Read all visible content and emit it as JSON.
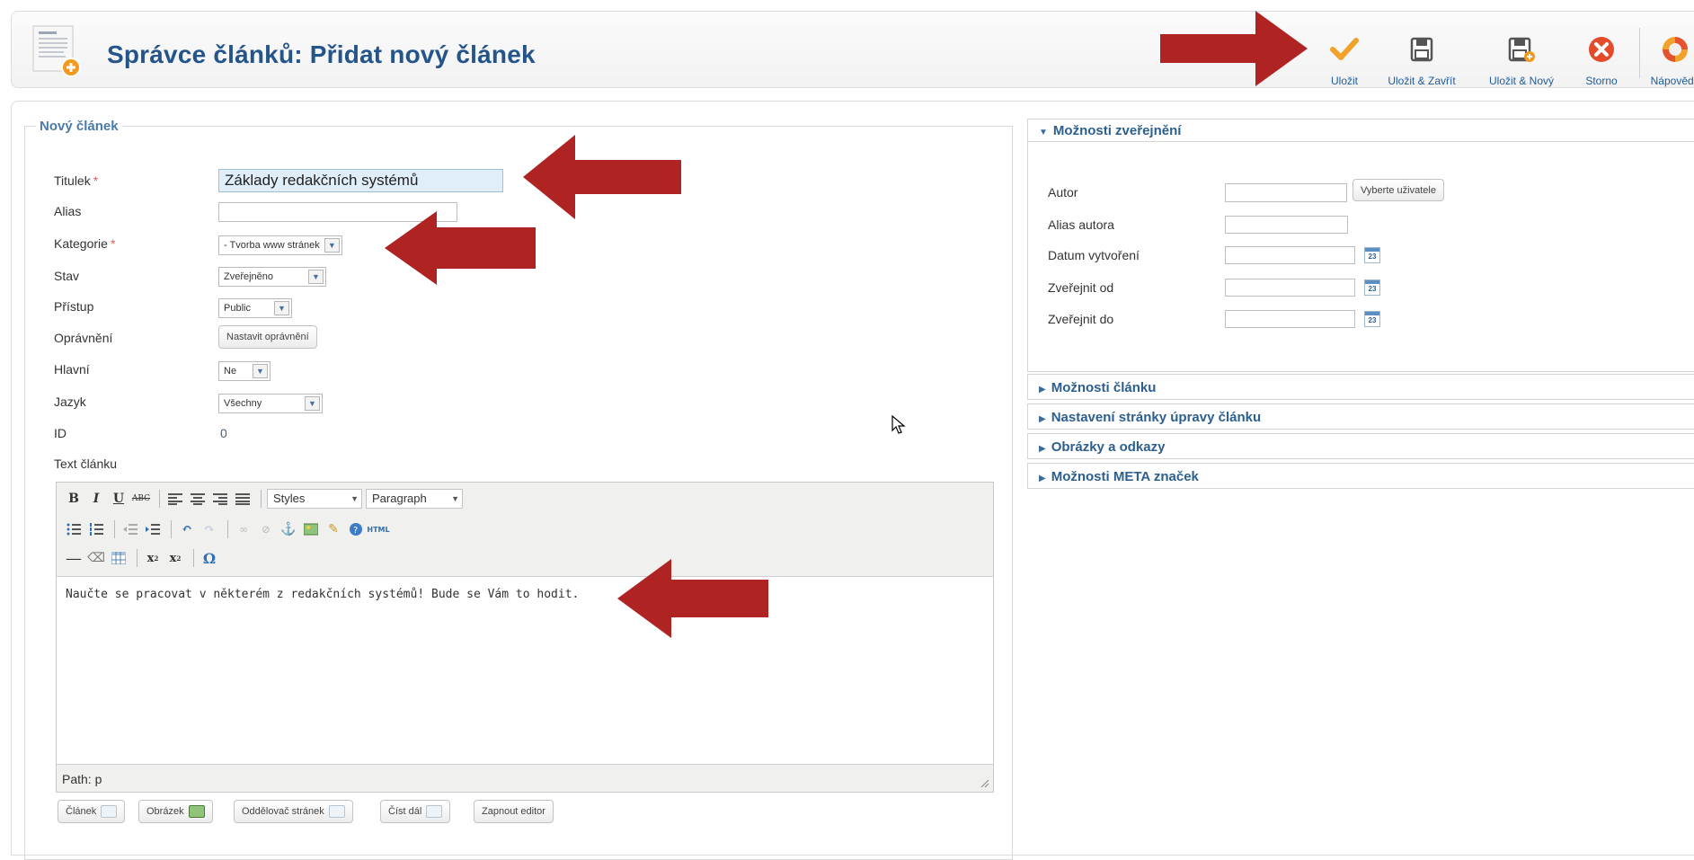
{
  "header": {
    "title": "Správce článků: Přidat nový článek",
    "toolbar": [
      {
        "label": "Uložit",
        "icon": "checkmark-icon"
      },
      {
        "label": "Uložit & Zavřít",
        "icon": "save-icon"
      },
      {
        "label": "Uložit & Nový",
        "icon": "save-new-icon"
      },
      {
        "label": "Storno",
        "icon": "cancel-icon"
      },
      {
        "label": "Nápověda",
        "icon": "help-icon"
      }
    ]
  },
  "form": {
    "legend": "Nový článek",
    "fields": {
      "title": {
        "label": "Titulek",
        "value": "Základy redakčních systémů"
      },
      "alias": {
        "label": "Alias",
        "value": ""
      },
      "category": {
        "label": "Kategorie",
        "value": "- Tvorba www stránek"
      },
      "state": {
        "label": "Stav",
        "value": "Zveřejněno"
      },
      "access": {
        "label": "Přístup",
        "value": "Public"
      },
      "permissions": {
        "label": "Oprávnění",
        "button": "Nastavit oprávnění"
      },
      "featured": {
        "label": "Hlavní",
        "value": "Ne"
      },
      "language": {
        "label": "Jazyk",
        "value": "Všechny"
      },
      "id": {
        "label": "ID",
        "value": "0"
      },
      "text": {
        "label": "Text článku"
      }
    },
    "required_mark": "*"
  },
  "editor": {
    "styles_select": "Styles",
    "format_select": "Paragraph",
    "content": "Naučte se pracovat v některém z redakčních systémů! Bude se Vám to hodit.",
    "path": "Path: p",
    "html_label": "HTML",
    "buttons": [
      "Článek",
      "Obrázek",
      "Oddělovač stránek",
      "Číst dál",
      "Zapnout editor"
    ]
  },
  "publishing": {
    "header": "Možnosti zveřejnění",
    "author_label": "Autor",
    "select_user_button": "Vyberte uživatele",
    "author_alias_label": "Alias autora",
    "created_label": "Datum vytvoření",
    "publish_up_label": "Zveřejnit od",
    "publish_down_label": "Zveřejnit do",
    "calendar_day": "23"
  },
  "collapsed_panels": [
    "Možnosti článku",
    "Nastavení stránky úpravy článku",
    "Obrázky a odkazy",
    "Možnosti META značek"
  ],
  "colors": {
    "title_blue": "#24558a",
    "arrow_red": "#b02323",
    "input_focus": "#dfeef9"
  }
}
